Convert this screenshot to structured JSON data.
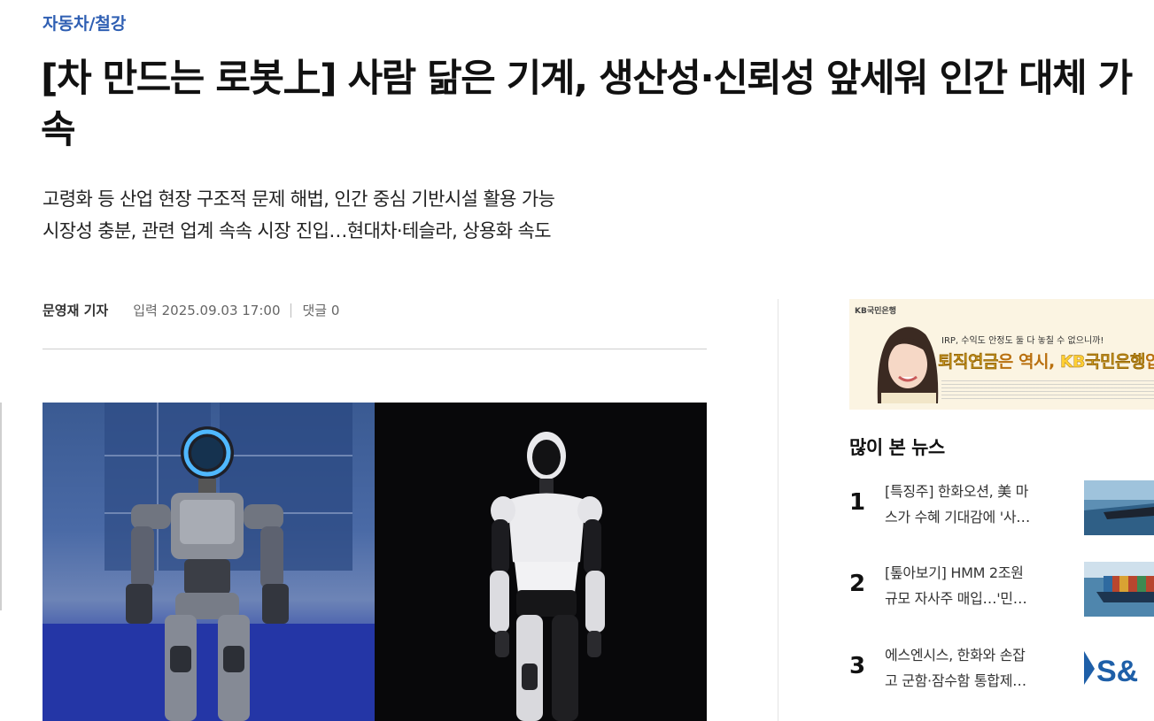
{
  "article": {
    "category": "자동차/철강",
    "headline": "[차 만드는 로봇上] 사람 닮은 기계, 생산성·신뢰성 앞세워 인간 대체 가속",
    "subtitle_lines": [
      "고령화 등 산업 현장 구조적 문제 해법, 인간 중심 기반시설 활용 가능",
      "시장성 충분, 관련 업계 속속 시장 진입…현대차·테슬라, 상용화 속도"
    ],
    "author": "문영재 기자",
    "published": "입력 2025.09.03 17:00",
    "comments": "댓글 0"
  },
  "ad": {
    "logo": "KB국민은행",
    "line1": "IRP, 수익도 안정도 둘 다 놓칠 수 없으니까!",
    "line2_prefix": "퇴직연금",
    "line2_mid": "은 역시, ",
    "line2_brand": "KB국민은행",
    "line2_suffix": "입니"
  },
  "popular": {
    "title": "많이 본 뉴스",
    "items": [
      {
        "rank": "1",
        "line1": "[특징주] 한화오션, 美 마",
        "line2": "스가 수혜 기대감에 '사…"
      },
      {
        "rank": "2",
        "line1": "[톺아보기] HMM 2조원",
        "line2": "규모 자사주 매입…'민…"
      },
      {
        "rank": "3",
        "line1": "에스엔시스, 한화와 손잡",
        "line2": "고 군함·잠수함 통합제…"
      }
    ],
    "thumb3_text": "S&"
  }
}
